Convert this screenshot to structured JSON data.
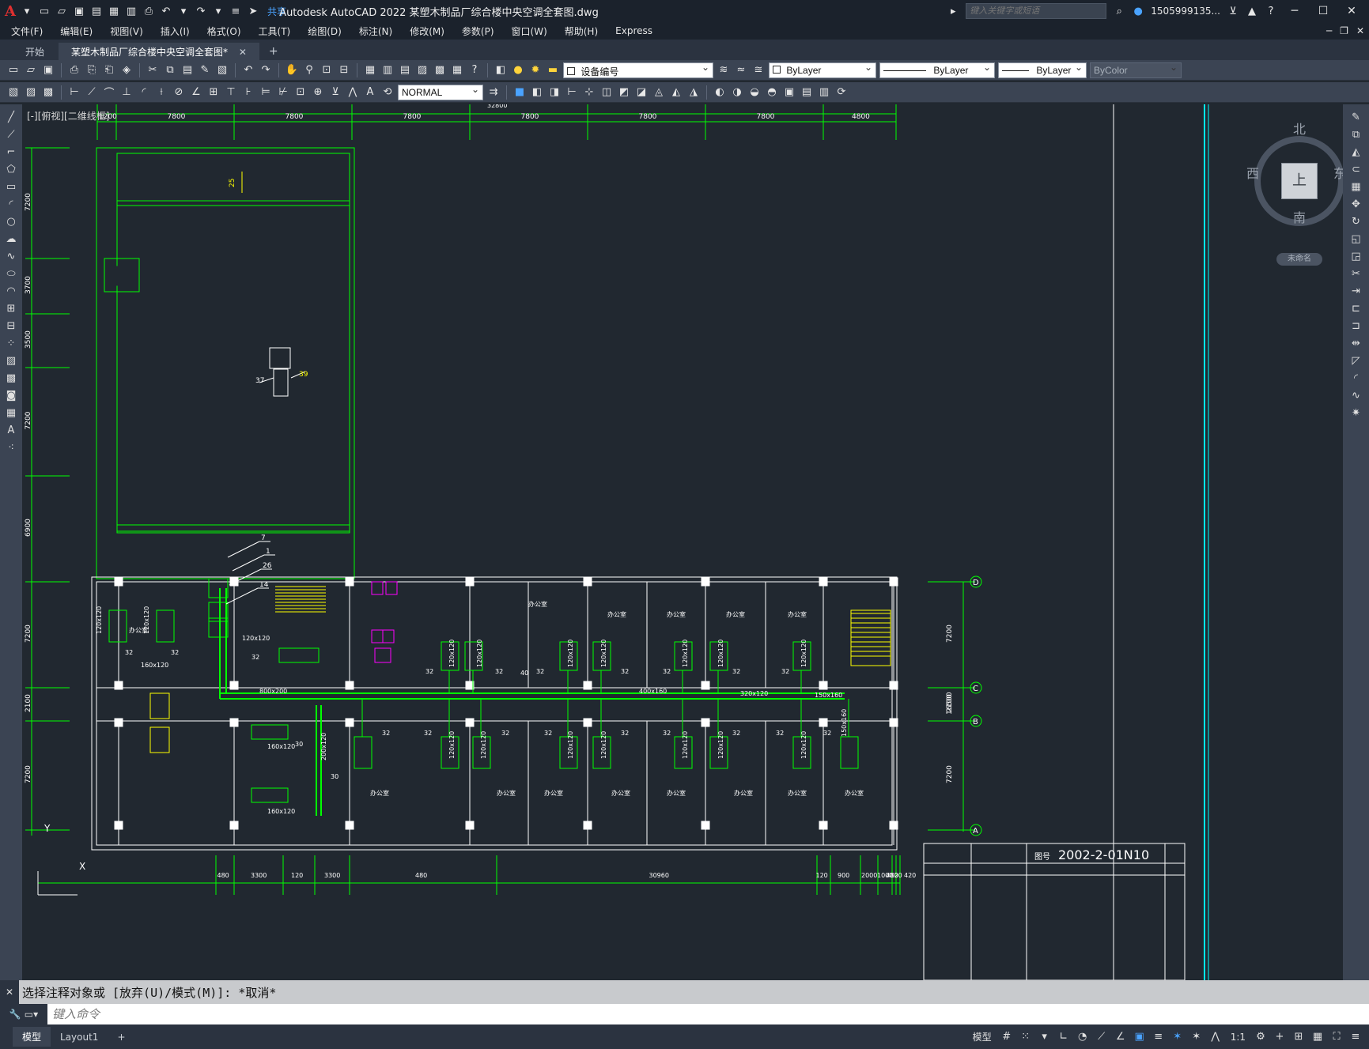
{
  "titlebar": {
    "app_logo": "A",
    "share_label": "共享",
    "title": "Autodesk AutoCAD 2022    某塑木制品厂综合楼中央空调全套图.dwg",
    "search_placeholder": "键入关键字或短语",
    "user": "1505999135...",
    "help": "?"
  },
  "menu": {
    "items": [
      "文件(F)",
      "编辑(E)",
      "视图(V)",
      "插入(I)",
      "格式(O)",
      "工具(T)",
      "绘图(D)",
      "标注(N)",
      "修改(M)",
      "参数(P)",
      "窗口(W)",
      "帮助(H)",
      "Express"
    ]
  },
  "tabs": {
    "start": "开始",
    "active": "某塑木制品厂综合楼中央空调全套图*",
    "add": "+"
  },
  "toolbar1": {
    "layer": "设备编号",
    "color": "ByLayer",
    "linetype": "ByLayer",
    "lineweight": "ByLayer",
    "plotstyle": "ByColor"
  },
  "toolbar2": {
    "textstyle": "NORMAL"
  },
  "drawing": {
    "view_label": "[-][俯视][二维线框]",
    "top_dims": [
      "1200",
      "7800",
      "7800",
      "7800",
      "7800",
      "7800",
      "7800",
      "4800"
    ],
    "top_total": "32800",
    "left_dims": [
      "7200",
      "3700",
      "3500",
      "7200",
      "6900",
      "7200",
      "2100",
      "7200"
    ],
    "right_dims": [
      "7200",
      "2100",
      "7200"
    ],
    "right_total": "16500",
    "axis_labels": [
      "D",
      "C",
      "B",
      "A"
    ],
    "bottom_dims": [
      "480",
      "3300",
      "120",
      "3300",
      "480",
      "30960",
      "120",
      "900",
      "2000",
      "1000",
      "480",
      "120",
      "420"
    ],
    "room_label": "办公室",
    "duct_labels": [
      "120x120",
      "160x120",
      "800x200",
      "200x120",
      "400x160",
      "320x120",
      "150x160"
    ],
    "callouts": [
      "7",
      "1",
      "26",
      "14",
      "37",
      "39",
      "25",
      "32",
      "30",
      "40"
    ],
    "drawing_no_label": "图号",
    "drawing_no": "2002-2-01N10",
    "compass": {
      "north": "北",
      "south": "南",
      "east": "东",
      "west": "西",
      "face": "上",
      "wcs": "未命名"
    }
  },
  "command": {
    "history": "选择注释对象或 [放弃(U)/模式(M)]: *取消*",
    "placeholder": "键入命令"
  },
  "statusbar": {
    "model_tab": "模型",
    "layout_tab": "Layout1",
    "add": "+",
    "model_button": "模型",
    "scale": "1:1"
  },
  "colors": {
    "background": "#212830",
    "linework": "#00ff00",
    "white_lines": "#ffffff",
    "yellow": "#ffff00",
    "magenta": "#ff00ff",
    "cyan": "#00ffff"
  }
}
